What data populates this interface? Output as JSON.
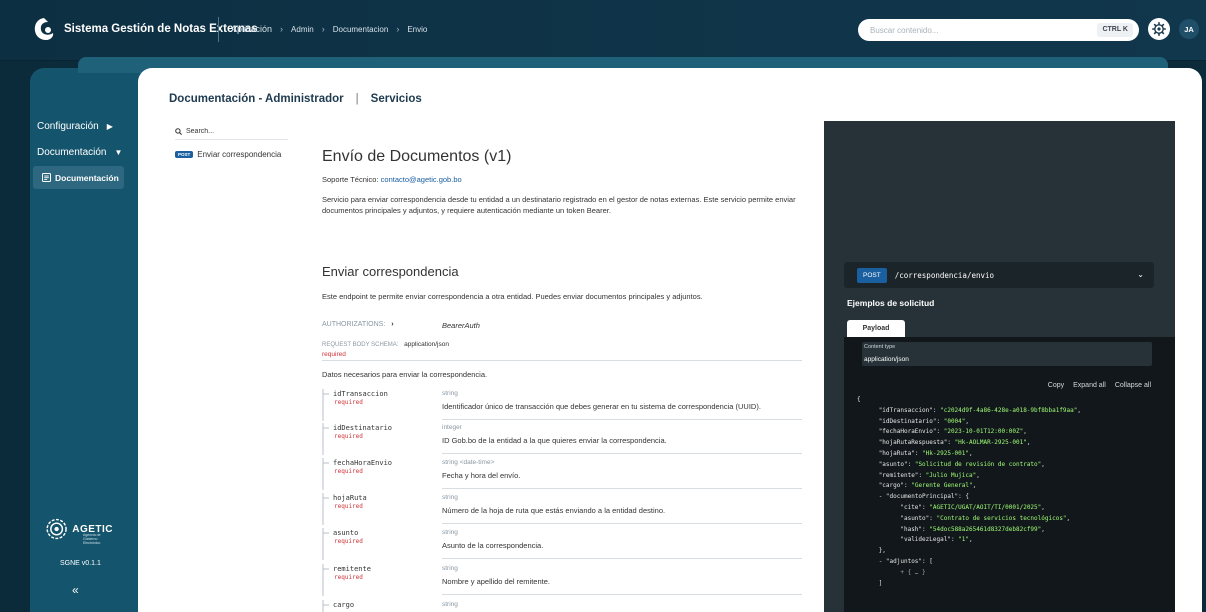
{
  "topbar": {
    "app_title": "Sistema Gestión de Notas Externas",
    "breadcrumbs": [
      "Aplicación",
      "Admin",
      "Documentacion",
      "Envio"
    ],
    "search_placeholder": "Buscar contenido...",
    "shortcut": "CTRL K",
    "avatar_initials": "JA"
  },
  "sidebar": {
    "items": [
      {
        "label": "Configuración",
        "icon": "chevron-right-icon"
      },
      {
        "label": "Documentación",
        "icon": "chevron-down-icon"
      }
    ],
    "active_item": "Documentación",
    "org_name": "AGETIC",
    "org_sub": "Agencia de Gobierno Electrónico",
    "version": "SGNE v0.1.1",
    "collapse_icon": "«"
  },
  "header": {
    "left": "Documentación - Administrador",
    "right": "Servicios"
  },
  "ref_nav": {
    "search_placeholder": "Search...",
    "operation_badge": "POST",
    "operation_label": "Enviar correspondencia"
  },
  "api": {
    "title": "Envío de Documentos (v1)",
    "support_label": "Soporte Técnico:",
    "support_email": "contacto@agetic.gob.bo",
    "description": "Servicio para enviar correspondencia desde tu entidad a un destinatario registrado en el gestor de notas externas. Este servicio permite enviar documentos principales y adjuntos, y requiere autenticación mediante un token Bearer."
  },
  "operation": {
    "title": "Enviar correspondencia",
    "description": "Este endpoint te permite enviar correspondencia a otra entidad. Puedes enviar documentos principales y adjuntos.",
    "authorizations_label": "AUTHORIZATIONS:",
    "authorizations_value": "BearerAuth",
    "schema_label": "REQUEST BODY SCHEMA:",
    "schema_content_type": "application/json",
    "schema_required": "required",
    "schema_description": "Datos necesarios para enviar la correspondencia.",
    "fields": [
      {
        "name": "idTransaccion",
        "required": "required",
        "type": "string",
        "description": "Identificador único de transacción que debes generar en tu sistema de correspondencia (UUID)."
      },
      {
        "name": "idDestinatario",
        "required": "required",
        "type": "integer",
        "description": "ID Gob.bo de la entidad a la que quieres enviar la correspondencia."
      },
      {
        "name": "fechaHoraEnvio",
        "required": "required",
        "type": "string <date-time>",
        "description": "Fecha y hora del envío."
      },
      {
        "name": "hojaRuta",
        "required": "required",
        "type": "string",
        "description": "Número de la hoja de ruta que estás enviando a la entidad destino."
      },
      {
        "name": "asunto",
        "required": "required",
        "type": "string",
        "description": "Asunto de la correspondencia."
      },
      {
        "name": "remitente",
        "required": "required",
        "type": "string",
        "description": "Nombre y apellido del remitente."
      },
      {
        "name": "cargo",
        "required": "",
        "type": "string",
        "description": ""
      }
    ]
  },
  "right_panel": {
    "method": "POST",
    "path": "/correspondencia/envio",
    "examples_title": "Ejemplos de solicitud",
    "tab_label": "Payload",
    "content_type_label": "Content type",
    "content_type_value": "application/json",
    "actions": [
      "Copy",
      "Expand all",
      "Collapse all"
    ],
    "json_lines": [
      {
        "indent": 0,
        "t": "{"
      },
      {
        "indent": 1,
        "k": "\"idTransaccion\"",
        "v": "\"c2024d9f-4a86-428e-a018-9bf8bba1f9aa\""
      },
      {
        "indent": 1,
        "k": "\"idDestinatario\"",
        "v": "\"0004\""
      },
      {
        "indent": 1,
        "k": "\"fechaHoraEnvio\"",
        "v": "\"2023-10-01T12:00:00Z\""
      },
      {
        "indent": 1,
        "k": "\"hojaRutaRespuesta\"",
        "v": "\"Hk-AOLMAR-2925-001\""
      },
      {
        "indent": 1,
        "k": "\"hojaRuta\"",
        "v": "\"Hk-2925-001\""
      },
      {
        "indent": 1,
        "k": "\"asunto\"",
        "v": "\"Solicitud de revisión de contrato\""
      },
      {
        "indent": 1,
        "k": "\"remitente\"",
        "v": "\"Julio Mujica\""
      },
      {
        "indent": 1,
        "k": "\"cargo\"",
        "v": "\"Gerente General\""
      },
      {
        "indent": 1,
        "k": "- \"documentoPrincipal\"",
        "t2": "{"
      },
      {
        "indent": 2,
        "k": "\"cite\"",
        "v": "\"AGETIC/UGAT/AOIT/TI/0001/2025\""
      },
      {
        "indent": 2,
        "k": "\"asunto\"",
        "v": "\"Contrato de servicios tecnológicos\""
      },
      {
        "indent": 2,
        "k": "\"hash\"",
        "v": "\"54doc588a265461d8327deb82cf99\""
      },
      {
        "indent": 2,
        "k": "\"validezLegal\"",
        "v": "\"1\""
      },
      {
        "indent": 1,
        "t": "},"
      },
      {
        "indent": 1,
        "k": "- \"adjuntos\"",
        "t2": "["
      },
      {
        "indent": 2,
        "t": "+ { … }"
      },
      {
        "indent": 1,
        "t": "]"
      }
    ]
  }
}
